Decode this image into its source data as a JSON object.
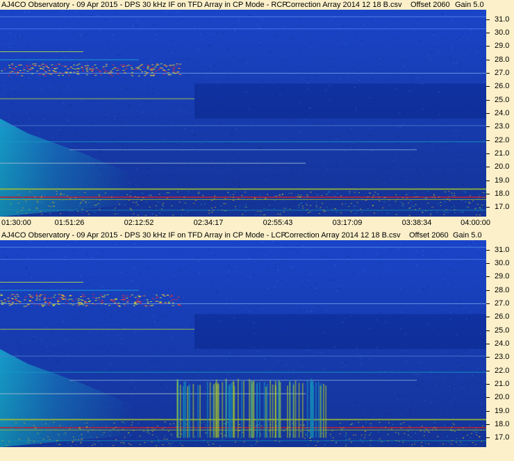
{
  "chart_data": [
    {
      "type": "heatmap",
      "title": "AJ4CO Observatory - 09 Apr 2015 - DPS 30 kHz IF on TFD Array in CP Mode - RCP",
      "correction": "Correction Array 2014 12 18 B.csv",
      "offset": "Offset 2060",
      "gain": "Gain 5.0",
      "x_ticks": [
        "01:30:00",
        "01:51:26",
        "02:12:52",
        "02:34:17",
        "02:55:43",
        "03:17:09",
        "03:38:34",
        "04:00:00"
      ],
      "y_ticks": [
        "31.0",
        "30.0",
        "29.0",
        "28.0",
        "27.0",
        "26.0",
        "25.0",
        "24.0",
        "23.0",
        "22.0",
        "21.0",
        "20.0",
        "19.0",
        "18.0",
        "17.0"
      ],
      "ylim": [
        16.3,
        31.7
      ]
    },
    {
      "type": "heatmap",
      "title": "AJ4CO Observatory - 09 Apr 2015 - DPS 30 kHz IF on TFD Array in CP Mode - LCP",
      "correction": "Correction Array 2014 12 18 B.csv",
      "offset": "Offset 2060",
      "gain": "Gain 5.0",
      "y_ticks": [
        "31.0",
        "30.0",
        "29.0",
        "28.0",
        "27.0",
        "26.0",
        "25.0",
        "24.0",
        "23.0",
        "22.0",
        "21.0",
        "20.0",
        "19.0",
        "18.0",
        "17.0"
      ],
      "ylim": [
        16.3,
        31.7
      ]
    }
  ],
  "colors": {
    "background": "#fbf0c9",
    "low": "#1a44c8",
    "mid": "#19b7e8",
    "high": "#c8f040",
    "peak": "#e8304a"
  }
}
